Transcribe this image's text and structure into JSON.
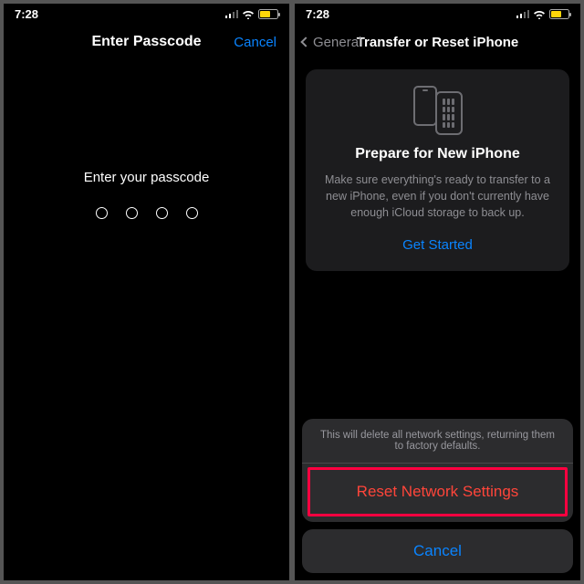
{
  "status": {
    "time": "7:28"
  },
  "left": {
    "nav_title": "Enter Passcode",
    "cancel": "Cancel",
    "prompt": "Enter your passcode",
    "passcode_length": 4
  },
  "right": {
    "back_label": "General",
    "nav_title": "Transfer or Reset iPhone",
    "card": {
      "title": "Prepare for New iPhone",
      "desc": "Make sure everything's ready to transfer to a new iPhone, even if you don't currently have enough iCloud storage to back up.",
      "link": "Get Started"
    },
    "sheet": {
      "message": "This will delete all network settings, returning them to factory defaults.",
      "action": "Reset Network Settings",
      "cancel": "Cancel"
    }
  }
}
